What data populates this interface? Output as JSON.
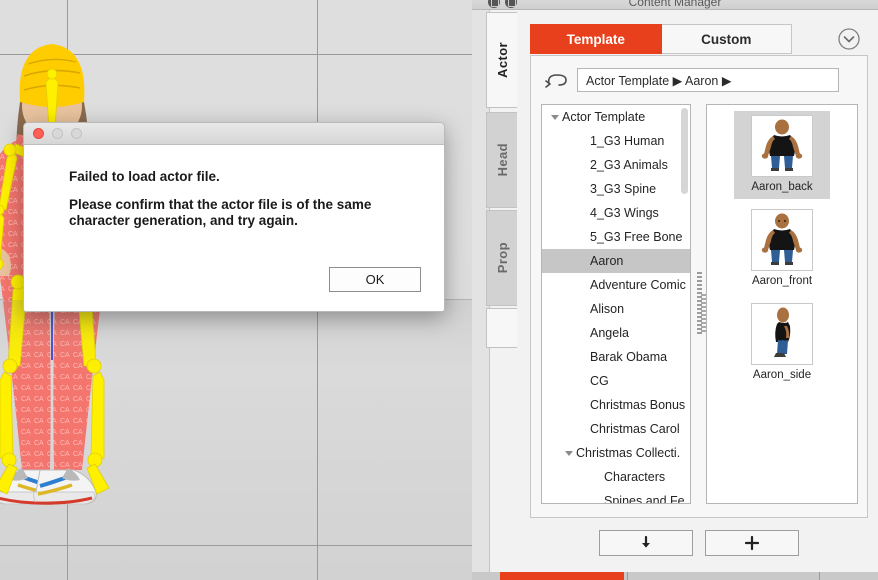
{
  "window": {
    "title": "Content Manager"
  },
  "viewport": {
    "name": "3d-viewport",
    "background_color": "#dcdcdc",
    "grid_color": "#9a9a9a",
    "character": {
      "name": "rigged-character",
      "beanie_color": "#FFCC00",
      "outfit_color": "#F4756E",
      "bone_color": "#FFF000",
      "skin_color": "#E8C39E",
      "shoe_color": "#FFFFFF"
    }
  },
  "dialog": {
    "name": "error-dialog",
    "title": "",
    "line1": "Failed to load actor file.",
    "line2": "Please confirm that the actor file is of the same character generation, and try again.",
    "ok_label": "OK",
    "close_tooltip": "Close",
    "minimize_tooltip": "Minimize",
    "maximize_tooltip": "Maximize"
  },
  "content_manager": {
    "vertical_tabs": [
      {
        "label": "Actor",
        "active": true
      },
      {
        "label": "Head",
        "active": false
      },
      {
        "label": "Prop",
        "active": false
      }
    ],
    "tabs": [
      {
        "label": "Template",
        "active": true
      },
      {
        "label": "Custom",
        "active": false
      }
    ],
    "accent_color": "#E8401C",
    "collapse_icon": "chevron-down-circle-icon",
    "back_icon": "back-arrow-icon",
    "breadcrumb": "Actor Template ▶ Aaron ▶",
    "breadcrumb_parts": [
      "Actor Template",
      "Aaron"
    ],
    "tree": [
      {
        "label": "Actor Template",
        "level": 0,
        "expanded": true,
        "selected": false
      },
      {
        "label": "1_G3 Human",
        "level": 1,
        "expanded": null,
        "selected": false
      },
      {
        "label": "2_G3 Animals",
        "level": 1,
        "expanded": null,
        "selected": false
      },
      {
        "label": "3_G3 Spine",
        "level": 1,
        "expanded": null,
        "selected": false
      },
      {
        "label": "4_G3 Wings",
        "level": 1,
        "expanded": null,
        "selected": false
      },
      {
        "label": "5_G3 Free Bone",
        "level": 1,
        "expanded": null,
        "selected": false
      },
      {
        "label": "Aaron",
        "level": 1,
        "expanded": null,
        "selected": true
      },
      {
        "label": "Adventure Comic .",
        "level": 1,
        "expanded": null,
        "selected": false
      },
      {
        "label": "Alison",
        "level": 1,
        "expanded": null,
        "selected": false
      },
      {
        "label": "Angela",
        "level": 1,
        "expanded": null,
        "selected": false
      },
      {
        "label": "Barak Obama",
        "level": 1,
        "expanded": null,
        "selected": false
      },
      {
        "label": "CG",
        "level": 1,
        "expanded": null,
        "selected": false
      },
      {
        "label": "Christmas Bonus",
        "level": 1,
        "expanded": null,
        "selected": false
      },
      {
        "label": "Christmas Carol",
        "level": 1,
        "expanded": null,
        "selected": false
      },
      {
        "label": "Christmas Collecti.",
        "level": 1,
        "expanded": true,
        "selected": false
      },
      {
        "label": "Characters",
        "level": 2,
        "expanded": null,
        "selected": false
      },
      {
        "label": "Spines and Fe.",
        "level": 2,
        "expanded": null,
        "selected": false
      }
    ],
    "thumbnails": [
      {
        "label": "Aaron_back",
        "selected": true,
        "pose": "back"
      },
      {
        "label": "Aaron_front",
        "selected": false,
        "pose": "front"
      },
      {
        "label": "Aaron_side",
        "selected": false,
        "pose": "side"
      }
    ],
    "bottom_buttons": [
      {
        "name": "download-button",
        "icon": "download-arrow-icon"
      },
      {
        "name": "add-button",
        "icon": "plus-icon"
      }
    ]
  }
}
